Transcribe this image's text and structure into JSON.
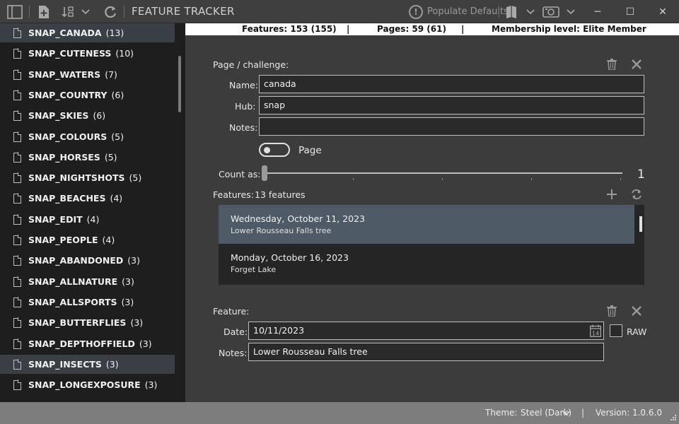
{
  "app": {
    "title": "FEATURE TRACKER"
  },
  "toolbar": {
    "populate_label": "Populate Defaults",
    "populate_glyph": "!"
  },
  "window_controls": {
    "minimize": "─",
    "maximize": "☐",
    "close": "✕"
  },
  "sidebar": {
    "items": [
      {
        "name": "SNAP_CANADA",
        "count": "(13)",
        "selected": true
      },
      {
        "name": "SNAP_CUTENESS",
        "count": "(10)",
        "selected": false
      },
      {
        "name": "SNAP_WATERS",
        "count": "(7)",
        "selected": false
      },
      {
        "name": "SNAP_COUNTRY",
        "count": "(6)",
        "selected": false
      },
      {
        "name": "SNAP_SKIES",
        "count": "(6)",
        "selected": false
      },
      {
        "name": "SNAP_COLOURS",
        "count": "(5)",
        "selected": false
      },
      {
        "name": "SNAP_HORSES",
        "count": "(5)",
        "selected": false
      },
      {
        "name": "SNAP_NIGHTSHOTS",
        "count": "(5)",
        "selected": false
      },
      {
        "name": "SNAP_BEACHES",
        "count": "(4)",
        "selected": false
      },
      {
        "name": "SNAP_EDIT",
        "count": "(4)",
        "selected": false
      },
      {
        "name": "SNAP_PEOPLE",
        "count": "(4)",
        "selected": false
      },
      {
        "name": "SNAP_ABANDONED",
        "count": "(3)",
        "selected": false
      },
      {
        "name": "SNAP_ALLNATURE",
        "count": "(3)",
        "selected": false
      },
      {
        "name": "SNAP_ALLSPORTS",
        "count": "(3)",
        "selected": false
      },
      {
        "name": "SNAP_BUTTERFLIES",
        "count": "(3)",
        "selected": false
      },
      {
        "name": "SNAP_DEPTHOFFIELD",
        "count": "(3)",
        "selected": false
      },
      {
        "name": "SNAP_INSECTS",
        "count": "(3)",
        "selected": true
      },
      {
        "name": "SNAP_LONGEXPOSURE",
        "count": "(3)",
        "selected": false
      }
    ]
  },
  "infobar": {
    "features": "Features: 153 (155)",
    "sep1": "|",
    "pages": "Pages: 59 (61)",
    "sep2": "|",
    "membership": "Membership level: Elite Member"
  },
  "page": {
    "section_label": "Page / challenge:",
    "name_label": "Name:",
    "name_value": "canada",
    "hub_label": "Hub:",
    "hub_value": "snap",
    "notes_label": "Notes:",
    "notes_value": "",
    "toggle_label": "Page",
    "count_label": "Count as:",
    "count_value": "1"
  },
  "features": {
    "label": "Features:",
    "count_text": "13 features",
    "items": [
      {
        "date": "Wednesday, October 11, 2023",
        "note": "Lower Rousseau Falls tree",
        "selected": true
      },
      {
        "date": "Monday, October 16, 2023",
        "note": "Forget Lake",
        "selected": false
      }
    ]
  },
  "feature": {
    "section_label": "Feature:",
    "date_label": "Date:",
    "date_value": "10/11/2023",
    "calendar_day": "14",
    "raw_label": "RAW",
    "notes_label": "Notes:",
    "notes_value": "Lower Rousseau Falls tree"
  },
  "statusbar": {
    "theme_label": "Theme:",
    "theme_value": "Steel (Dark)",
    "sep": "|",
    "version": "Version:   1.0.6.0"
  }
}
